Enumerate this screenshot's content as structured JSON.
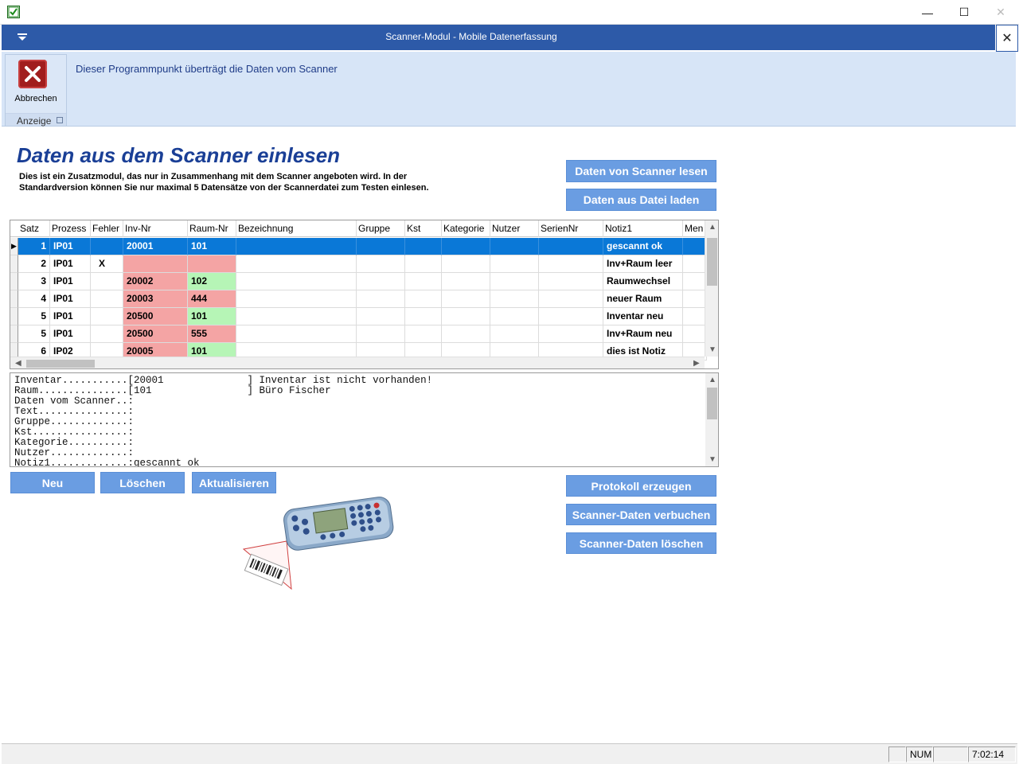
{
  "window": {
    "app_title": "Scanner-Modul - Mobile Datenerfassung",
    "controls": {
      "minimize": "—",
      "maximize": "☐",
      "close": "✕"
    }
  },
  "ribbon": {
    "cancel_label": "Abbrechen",
    "group_label": "Anzeige",
    "info_text": "Dieser Programmpunkt überträgt die Daten vom Scanner"
  },
  "main": {
    "heading": "Daten aus dem Scanner einlesen",
    "intro_line1": "Dies ist ein Zusatzmodul, das nur in Zusammenhang mit dem Scanner angeboten wird. In der",
    "intro_line2": "Standardversion können Sie nur maximal 5 Datensätze von der Scannerdatei zum Testen einlesen."
  },
  "buttons": {
    "read_scanner": "Daten von Scanner lesen",
    "load_file": "Daten aus Datei laden",
    "new": "Neu",
    "delete": "Löschen",
    "refresh": "Aktualisieren",
    "create_protocol": "Protokoll erzeugen",
    "book_data": "Scanner-Daten verbuchen",
    "delete_data": "Scanner-Daten löschen"
  },
  "grid": {
    "columns": [
      "Satz",
      "Prozess",
      "Fehler",
      "Inv-Nr",
      "Raum-Nr",
      "Bezeichnung",
      "Gruppe",
      "Kst",
      "Kategorie",
      "Nutzer",
      "SerienNr",
      "Notiz1",
      "Men"
    ],
    "rows": [
      {
        "satz": "1",
        "prozess": "IP01",
        "fehler": "",
        "inv": "20001",
        "raum": "101",
        "notiz": "gescannt ok",
        "selected": true,
        "inv_state": "",
        "raum_state": ""
      },
      {
        "satz": "2",
        "prozess": "IP01",
        "fehler": "X",
        "inv": "",
        "raum": "",
        "notiz": "Inv+Raum leer",
        "selected": false,
        "inv_state": "red",
        "raum_state": "red"
      },
      {
        "satz": "3",
        "prozess": "IP01",
        "fehler": "",
        "inv": "20002",
        "raum": "102",
        "notiz": "Raumwechsel",
        "selected": false,
        "inv_state": "red",
        "raum_state": "green"
      },
      {
        "satz": "4",
        "prozess": "IP01",
        "fehler": "",
        "inv": "20003",
        "raum": "444",
        "notiz": "neuer Raum",
        "selected": false,
        "inv_state": "red",
        "raum_state": "red"
      },
      {
        "satz": "5",
        "prozess": "IP01",
        "fehler": "",
        "inv": "20500",
        "raum": "101",
        "notiz": "Inventar neu",
        "selected": false,
        "inv_state": "red",
        "raum_state": "green"
      },
      {
        "satz": "5",
        "prozess": "IP01",
        "fehler": "",
        "inv": "20500",
        "raum": "555",
        "notiz": "Inv+Raum neu",
        "selected": false,
        "inv_state": "red",
        "raum_state": "red"
      },
      {
        "satz": "6",
        "prozess": "IP02",
        "fehler": "",
        "inv": "20005",
        "raum": "101",
        "notiz": "dies ist Notiz",
        "selected": false,
        "inv_state": "red",
        "raum_state": "green"
      }
    ]
  },
  "detail_lines": [
    "Inventar...........[20001              ] Inventar ist nicht vorhanden!",
    "Raum...............[101                ] Büro Fischer",
    "Daten vom Scanner..:",
    "Text...............:",
    "Gruppe.............:",
    "Kst................:",
    "Kategorie..........:",
    "Nutzer.............:",
    "Notiz1.............:gescannt ok"
  ],
  "status": {
    "num": "NUM",
    "time": "7:02:14"
  },
  "colors": {
    "accent": "#2d5aa8",
    "button": "#6a9de2",
    "selected_row": "#0a78d7",
    "error_cell": "#f4a4a4",
    "ok_cell": "#b6f5b6"
  }
}
